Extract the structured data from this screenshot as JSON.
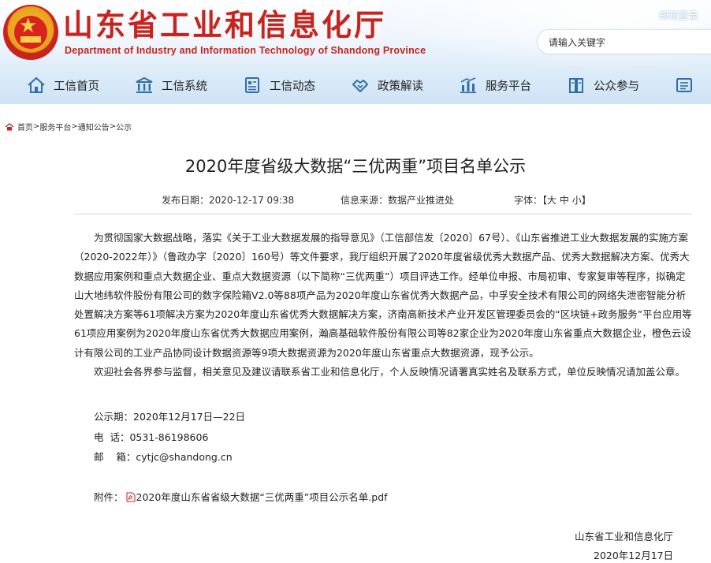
{
  "header": {
    "title_cn": "山东省工业和信息化厅",
    "title_en": "Department of Industry and Information Technology of Shandong Province",
    "login_link": "邮箱登录",
    "search_placeholder": "请输入关键字"
  },
  "nav": {
    "items": [
      {
        "label": "工信首页",
        "icon": "home-icon"
      },
      {
        "label": "工信系统",
        "icon": "building-icon"
      },
      {
        "label": "工信动态",
        "icon": "document-icon"
      },
      {
        "label": "政策解读",
        "icon": "handshake-icon"
      },
      {
        "label": "服务平台",
        "icon": "chart-icon"
      },
      {
        "label": "公众参与",
        "icon": "book-icon"
      }
    ],
    "colors": {
      "text": "#222222",
      "icon": "#2f6fa9"
    }
  },
  "breadcrumb": [
    "首页",
    "服务平台",
    "通知公告",
    "公示"
  ],
  "article": {
    "title": "2020年度省级大数据“三优两重”项目名单公示",
    "publish_date_label": "发布日期：2020-12-17 09:38",
    "source_label": "信息来源：数据产业推进处",
    "font_size_label": "字体：【",
    "font_sizes": [
      "大",
      "中",
      "小"
    ],
    "font_size_close": "】",
    "paragraphs": [
      "为贯彻国家大数据战略，落实《关于工业大数据发展的指导意见》（工信部信发〔2020〕67号）、《山东省推进工业大数据发展的实施方案（2020-2022年）》（鲁政办字〔2020〕160号）等文件要求，我厅组织开展了2020年度省级优秀大数据产品、优秀大数据解决方案、优秀大数据应用案例和重点大数据企业、重点大数据资源（以下简称“三优两重”）项目评选工作。经单位申报、市局初审、专家复审等程序，拟确定山大地纬软件股份有限公司的数字保险箱V2.0等88项产品为2020年度山东省优秀大数据产品，中孚安全技术有限公司的网络失泄密智能分析处置解决方案等61项解决方案为2020年度山东省优秀大数据解决方案，济南高新技术产业开发区管理委员会的“区块链+政务服务”平台应用等61项应用案例为2020年度山东省优秀大数据应用案例，瀚高基础软件股份有限公司等82家企业为2020年度山东省重点大数据企业，橙色云设计有限公司的工业产品协同设计数据资源等9项大数据资源为2020年度山东省重点大数据资源，现予公示。",
      "欢迎社会各界参与监督，相关意见及建议请联系省工业和信息化厅，个人反映情况请署真实姓名及联系方式，单位反映情况请加盖公章。"
    ],
    "period": "公示期：2020年12月17日—22日",
    "phone": "电  话：0531-86198606",
    "email": "邮    箱：cytjc@shandong.cn",
    "attachment_label": "附件：",
    "attachment_name": "2020年度山东省省级大数据“三优两重”项目公示名单.pdf",
    "signature_org": "山东省工业和信息化厅",
    "signature_date": "2020年12月17日"
  },
  "colors": {
    "brand_red": "#c8231d",
    "nav_icon_blue": "#2f6fa9"
  }
}
